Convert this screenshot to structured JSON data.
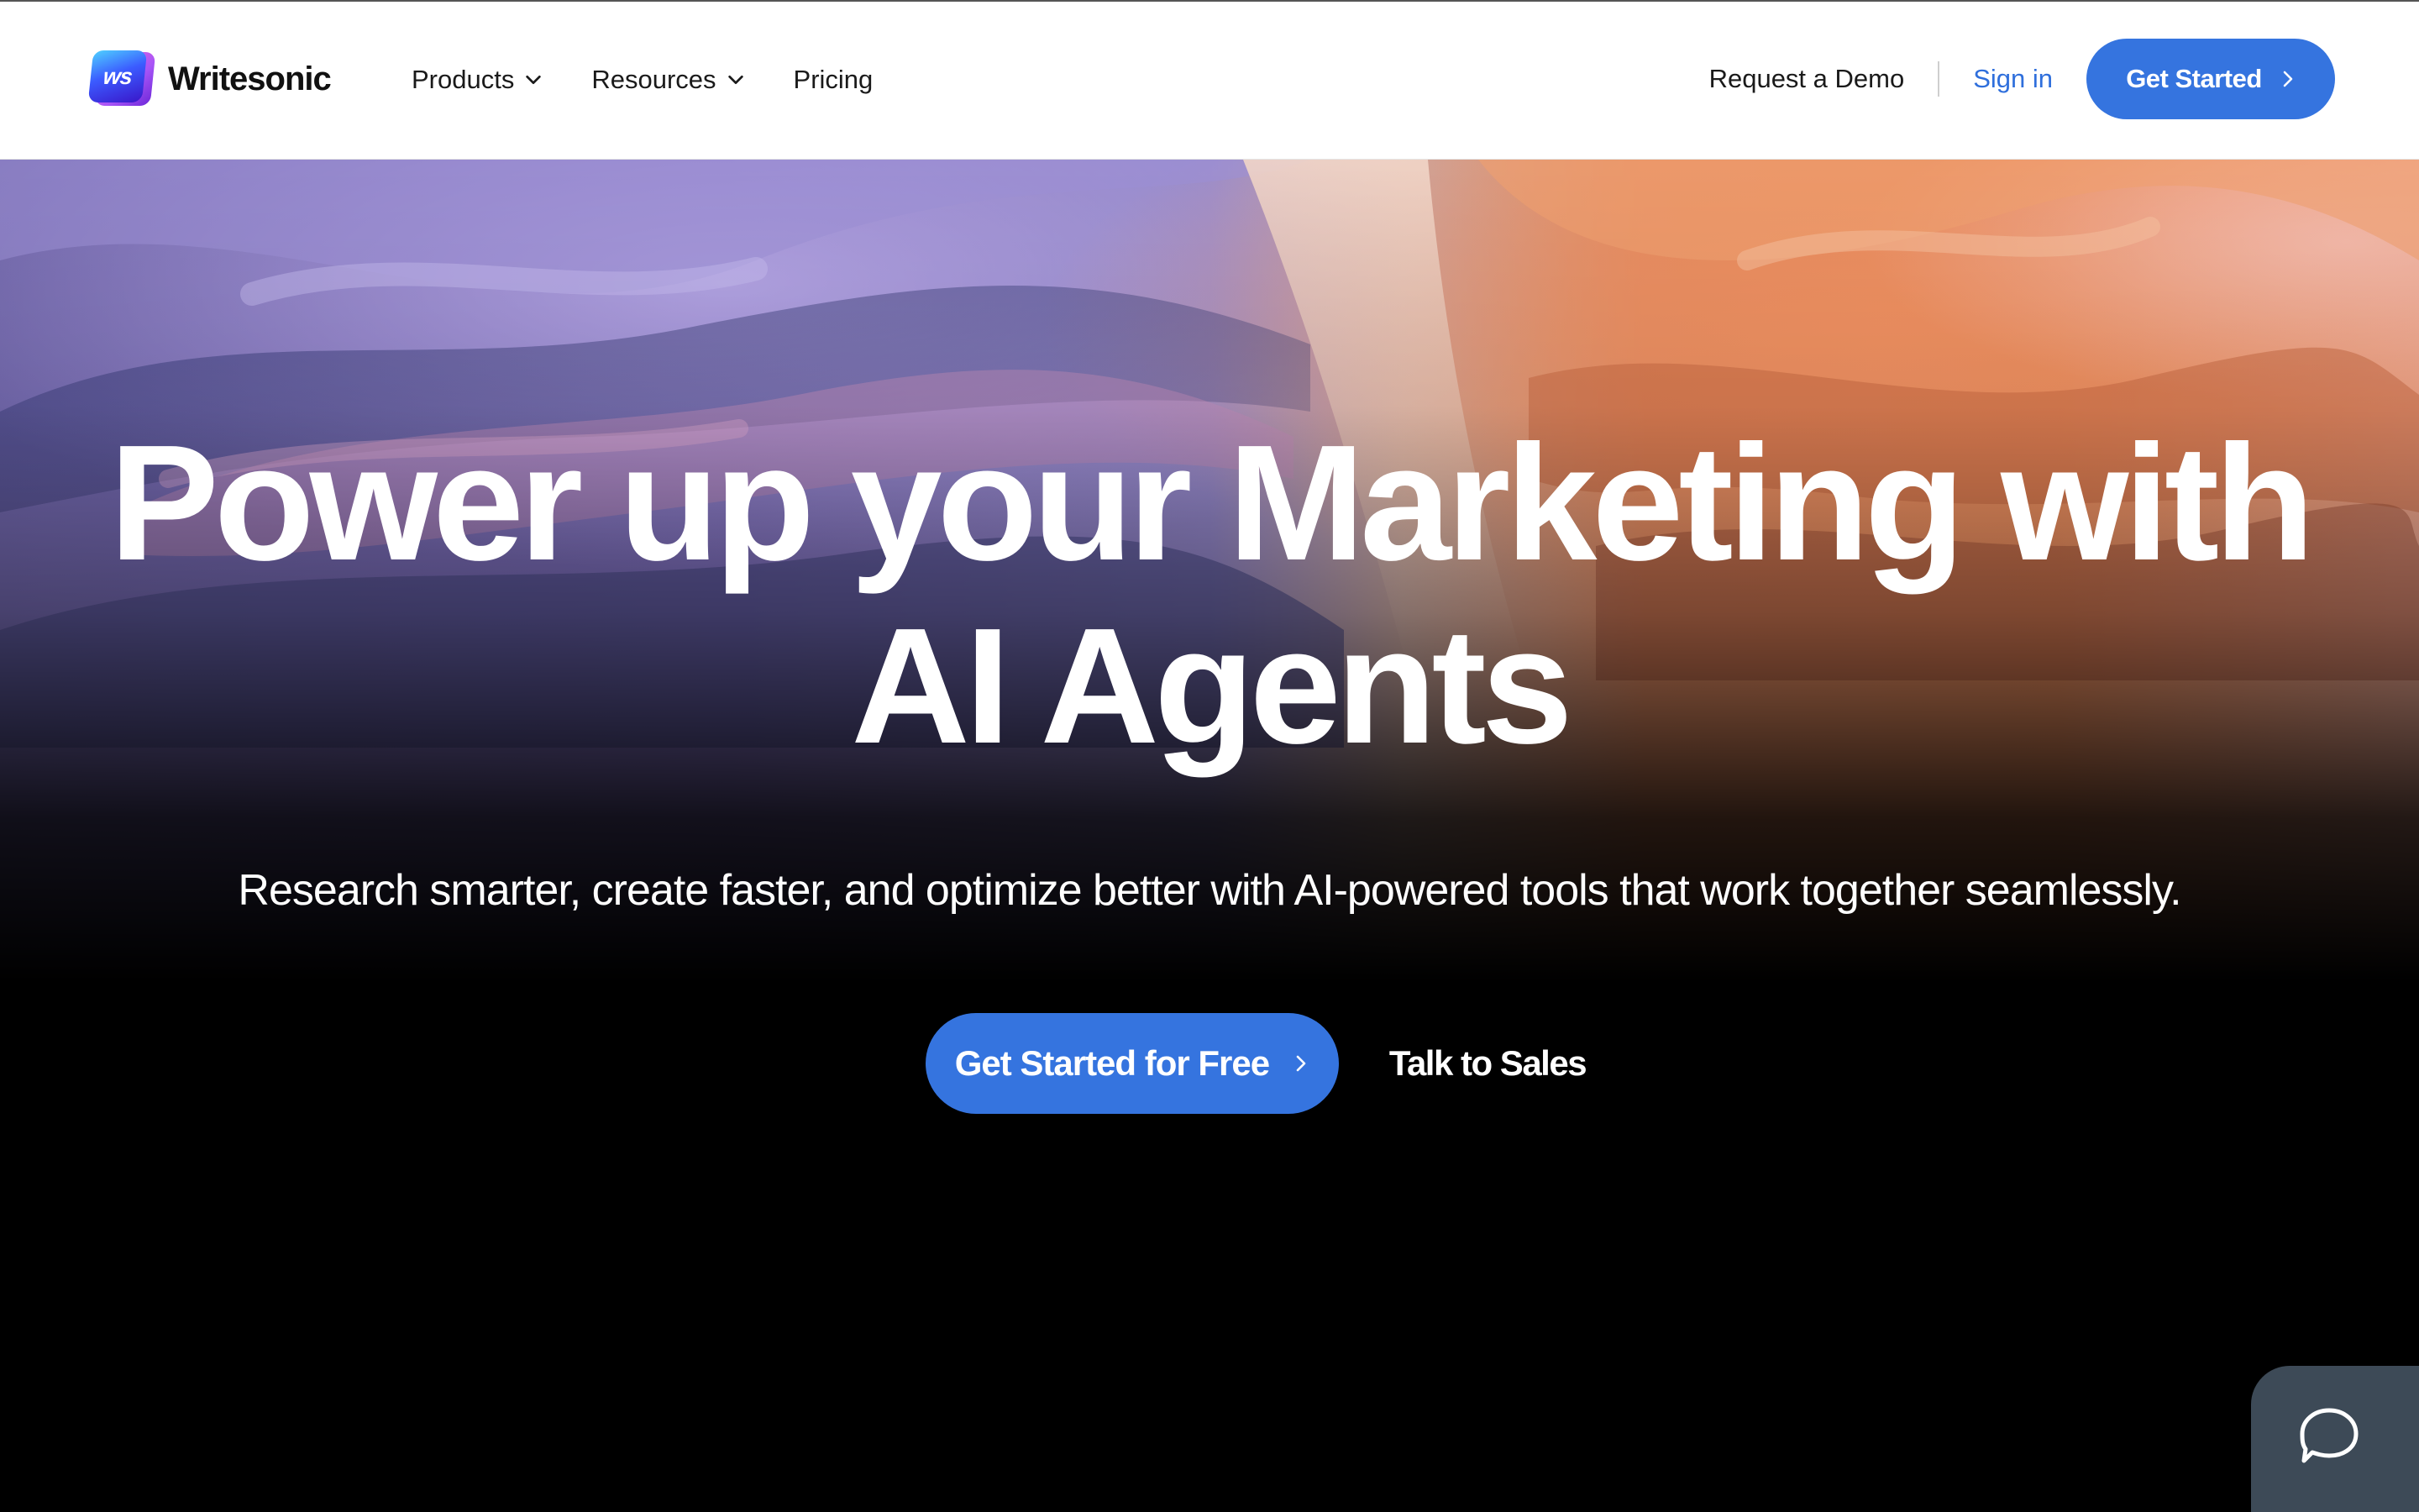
{
  "brand": {
    "logo_mark": "ws",
    "name": "Writesonic"
  },
  "nav": {
    "items": [
      {
        "label": "Products",
        "has_dropdown": true,
        "icon": "chevron-down-icon"
      },
      {
        "label": "Resources",
        "has_dropdown": true,
        "icon": "chevron-down-icon"
      },
      {
        "label": "Pricing",
        "has_dropdown": false
      }
    ],
    "request_demo": "Request a Demo",
    "sign_in": "Sign in",
    "get_started": "Get Started",
    "get_started_icon": "chevron-right-icon"
  },
  "hero": {
    "headline_line1": "Power up your Marketing with",
    "headline_line2": "AI Agents",
    "subtitle": "Research smarter, create faster, and optimize better with AI-powered tools that work together seamlessly.",
    "cta_primary": "Get Started for Free",
    "cta_primary_icon": "chevron-right-icon",
    "cta_secondary": "Talk to Sales"
  },
  "chat_widget": {
    "icon": "chat-bubble-icon"
  },
  "colors": {
    "primary_button": "#3574df",
    "sign_in_link": "#2f6fdc",
    "hero_text": "#ffffff",
    "nav_background": "#ffffff",
    "chat_widget": "#3d4a57"
  }
}
